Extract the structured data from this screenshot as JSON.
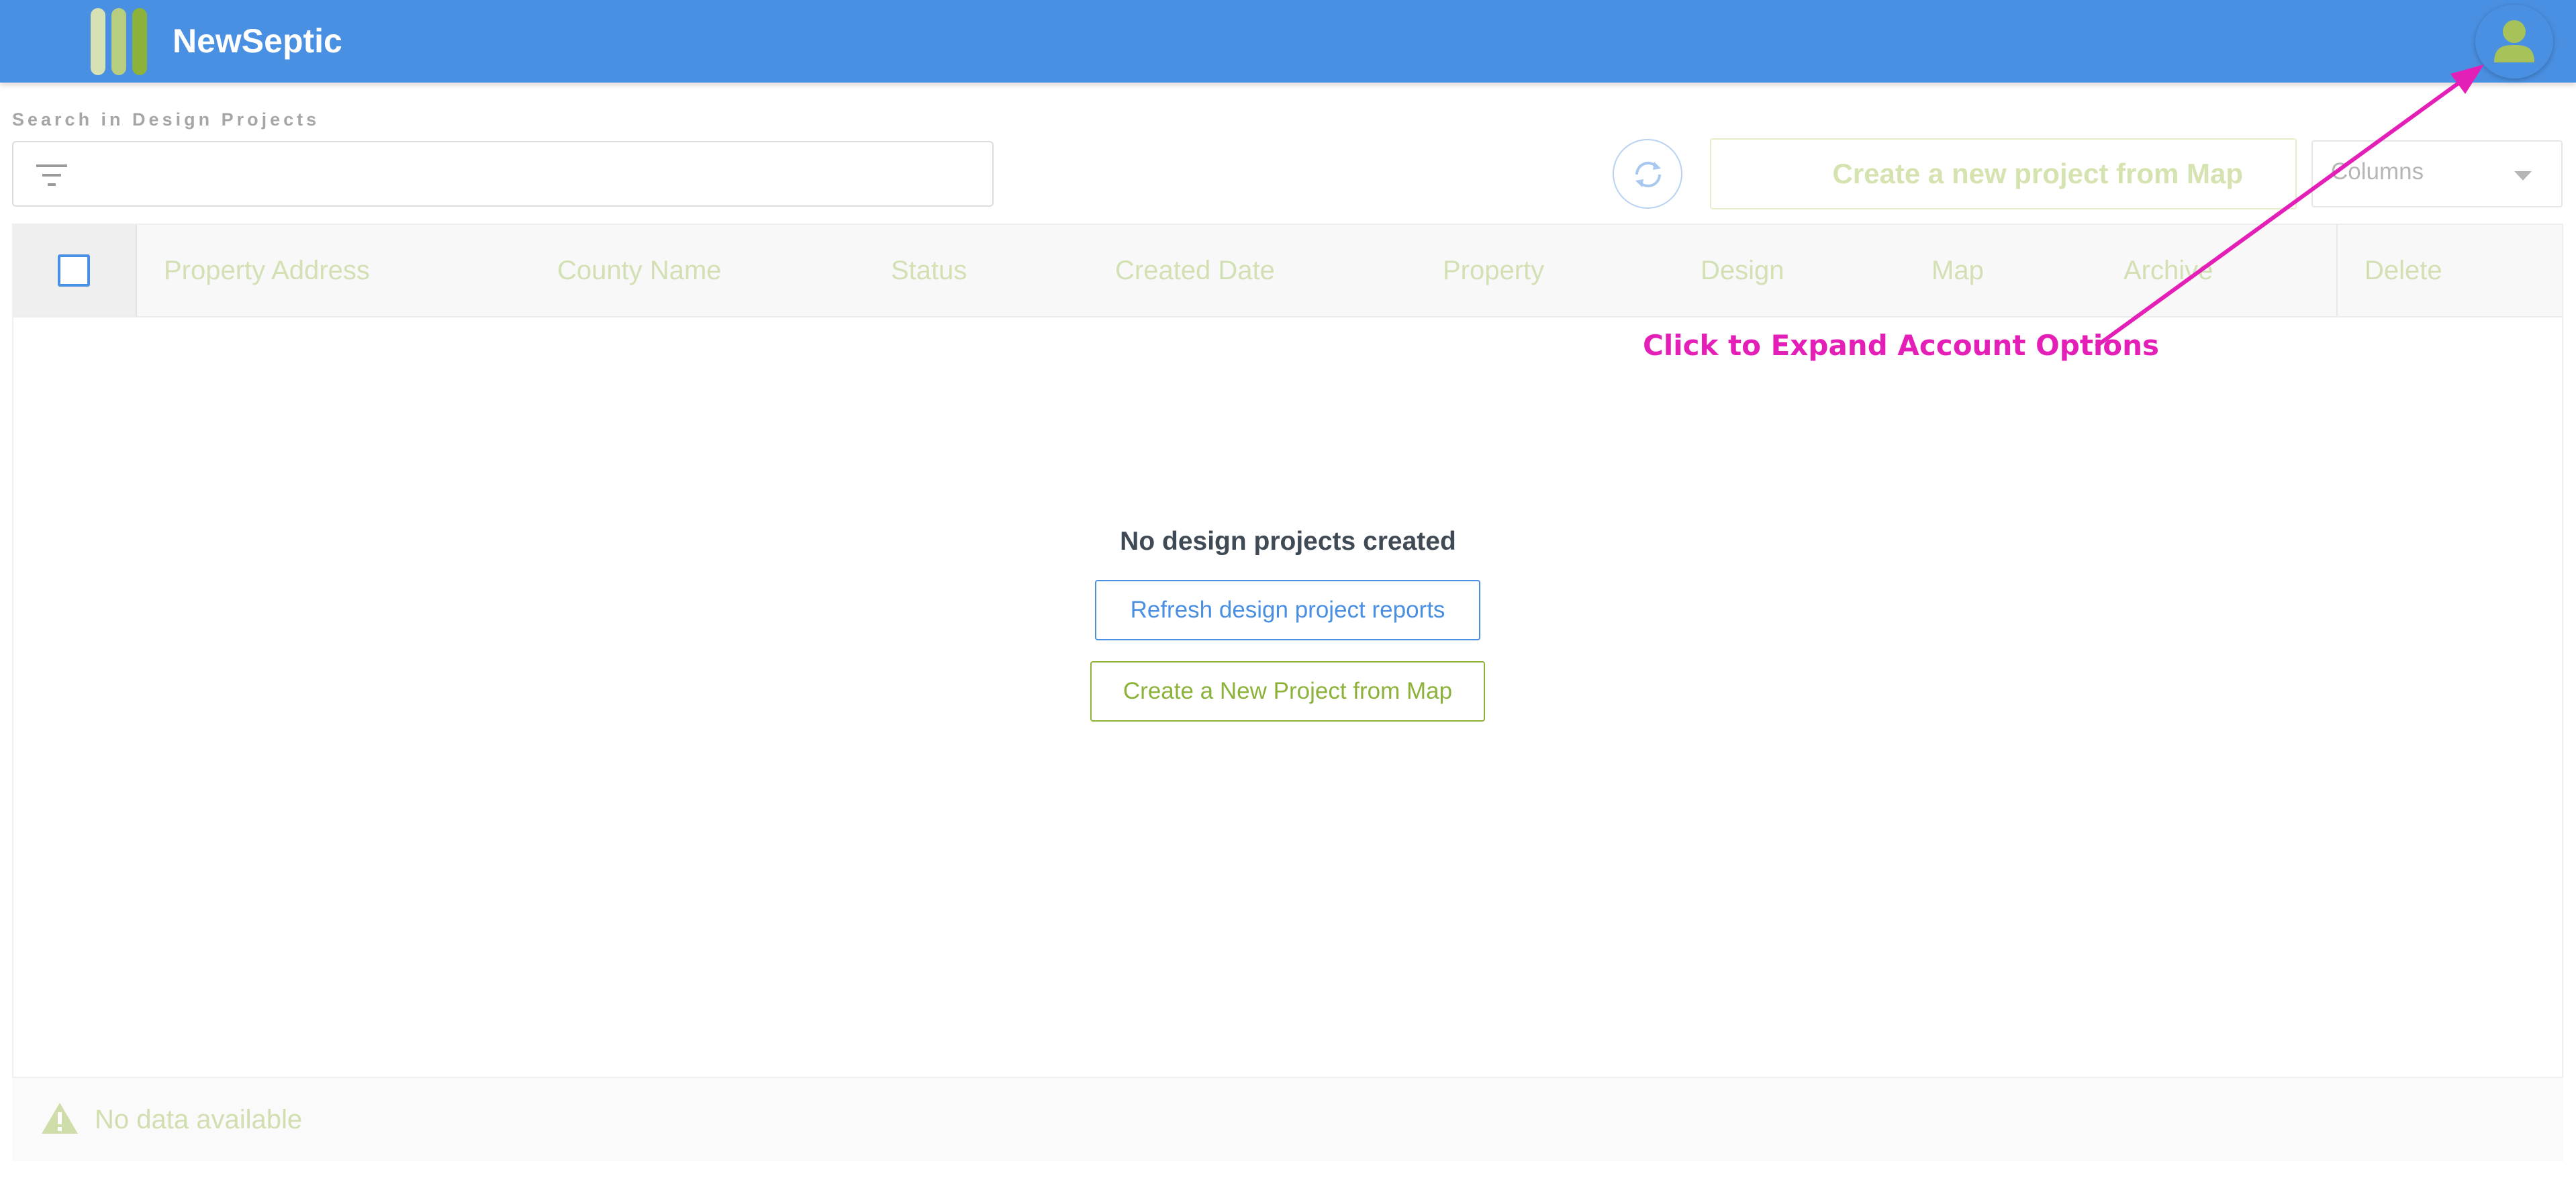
{
  "app": {
    "name": "NewSeptic"
  },
  "search": {
    "label": "Search in Design Projects",
    "value": "",
    "placeholder": ""
  },
  "toolbar": {
    "create_label": "Create a new project from Map",
    "columns_label": "Columns"
  },
  "table": {
    "columns": [
      "Property Address",
      "County Name",
      "Status",
      "Created Date",
      "Property",
      "Design",
      "Map",
      "Archive",
      "Delete"
    ],
    "rows": []
  },
  "empty_state": {
    "title": "No design projects created",
    "refresh_label": "Refresh design project reports",
    "create_label": "Create a New Project from Map"
  },
  "footer": {
    "no_data_text": "No data available"
  },
  "annotation": {
    "text": "Click to Expand Account Options"
  },
  "icons": {
    "logo": "logo-bars-icon",
    "avatar": "user-avatar-icon",
    "filter": "filter-icon",
    "refresh": "refresh-icon",
    "dropdown": "chevron-down-icon",
    "warning": "warning-icon"
  },
  "colors": {
    "header": "#4a90e2",
    "primary": "#4a90e2",
    "brand_green": "#8cb239",
    "annotation": "#e41fb8"
  }
}
